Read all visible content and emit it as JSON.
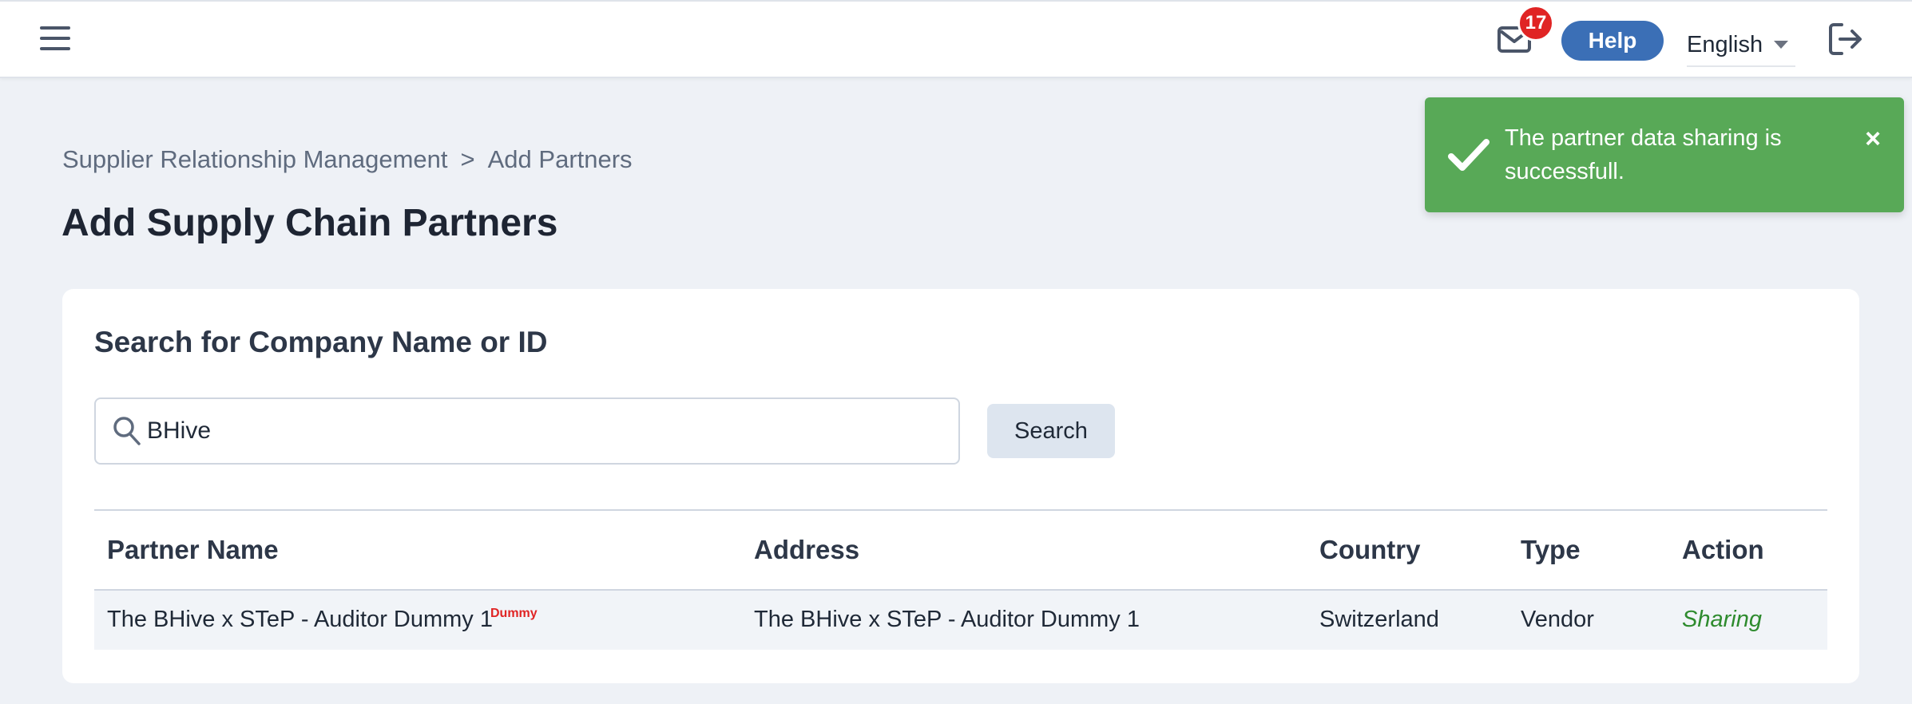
{
  "header": {
    "menu_icon": "hamburger-icon",
    "mail_icon": "envelope-icon",
    "unread_count": "17",
    "help_label": "Help",
    "language": "English",
    "logout_icon": "logout-icon"
  },
  "breadcrumb": {
    "items": [
      "Supplier Relationship Management",
      "Add Partners"
    ],
    "separator": ">"
  },
  "page_title": "Add Supply Chain Partners",
  "search": {
    "title": "Search for Company Name or ID",
    "value": "BHive",
    "button_label": "Search"
  },
  "table": {
    "columns": [
      "Partner Name",
      "Address",
      "Country",
      "Type",
      "Action"
    ],
    "rows": [
      {
        "partner_name": "The BHive x STeP - Auditor Dummy 1",
        "tag": "Dummy",
        "address": "The BHive x STeP - Auditor Dummy 1",
        "country": "Switzerland",
        "type": "Vendor",
        "action": "Sharing"
      }
    ]
  },
  "toast": {
    "message": "The partner data sharing is successfull.",
    "icon": "check-icon",
    "close_label": "×"
  },
  "colors": {
    "accent": "#3b6fb6",
    "badge": "#e02424",
    "toast_bg": "#58a957",
    "action_text": "#2e8b2e"
  }
}
